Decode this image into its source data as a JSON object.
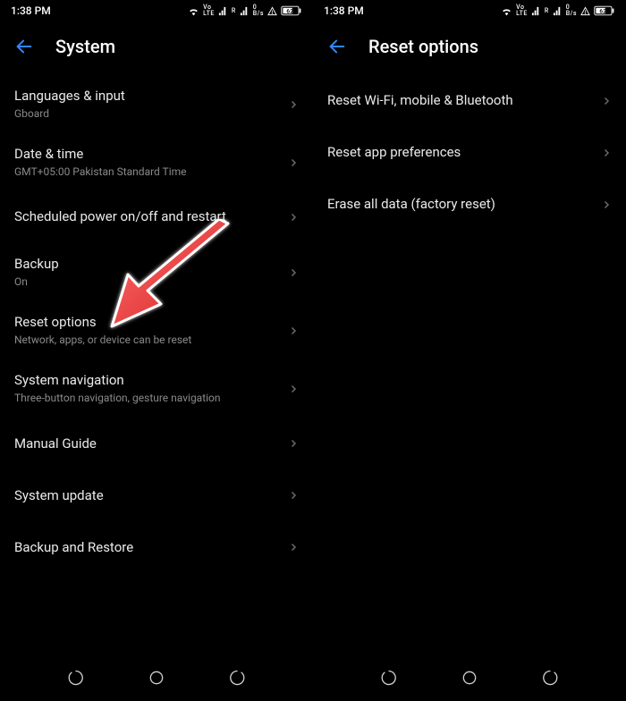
{
  "left": {
    "status": {
      "time": "1:38 PM",
      "battery": "62"
    },
    "header": {
      "title": "System"
    },
    "items": [
      {
        "title": "Languages & input",
        "subtitle": "Gboard"
      },
      {
        "title": "Date & time",
        "subtitle": "GMT+05:00 Pakistan Standard Time"
      },
      {
        "title": "Scheduled power on/off and restart",
        "subtitle": ""
      },
      {
        "title": "Backup",
        "subtitle": "On"
      },
      {
        "title": "Reset options",
        "subtitle": "Network, apps, or device can be reset"
      },
      {
        "title": "System navigation",
        "subtitle": "Three-button navigation, gesture navigation"
      },
      {
        "title": "Manual Guide",
        "subtitle": ""
      },
      {
        "title": "System update",
        "subtitle": ""
      },
      {
        "title": "Backup and Restore",
        "subtitle": ""
      }
    ]
  },
  "right": {
    "status": {
      "time": "1:38 PM",
      "battery": "62"
    },
    "header": {
      "title": "Reset options"
    },
    "items": [
      {
        "title": "Reset Wi-Fi, mobile & Bluetooth",
        "subtitle": ""
      },
      {
        "title": "Reset app preferences",
        "subtitle": ""
      },
      {
        "title": "Erase all data (factory reset)",
        "subtitle": ""
      }
    ]
  }
}
